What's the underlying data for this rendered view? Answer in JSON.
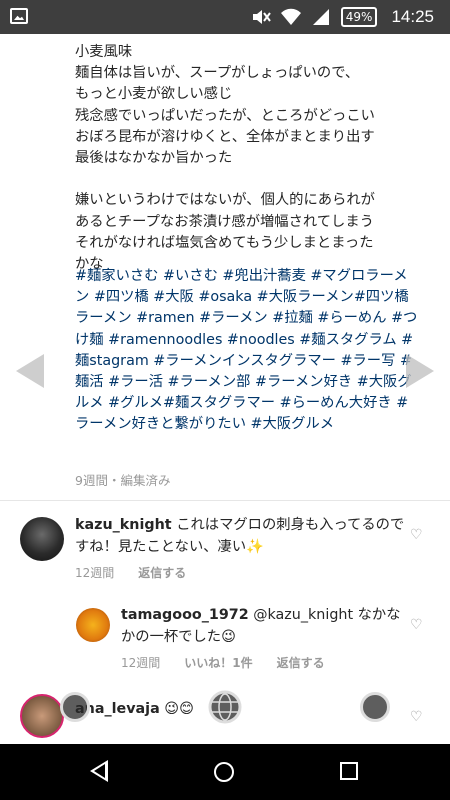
{
  "status_bar": {
    "battery": "49%",
    "time": "14:25"
  },
  "post": {
    "caption": "小麦風味\n麺自体は旨いが、スープがしょっぱいので、\nもっと小麦が欲しい感じ\n残念感でいっぱいだったが、ところがどっこい\nおぼろ昆布が溶けゆくと、全体がまとまり出す\n最後はなかなか旨かった\n\n嫌いというわけではないが、個人的にあられが\nあるとチープなお茶漬け感が増幅されてしまう\nそれがなければ塩気含めてもう少しまとまった\nかな",
    "hashtags": "#麺家いさむ #いさむ #兜出汁蕎麦 #マグロラーメン #四ツ橋 #大阪 #osaka #大阪ラーメン#四ツ橋ラーメン #ramen #ラーメン #拉麺 #らーめん #つけ麺 #ramennoodles #noodles #麺スタグラム #麺stagram #ラーメンインスタグラマー #ラー写 #麺活 #ラー活 #ラーメン部 #ラーメン好き #大阪グルメ #グルメ#麺スタグラマー #らーめん大好き #ラーメン好きと繋がりたい #大阪グルメ",
    "meta": "9週間・編集済み"
  },
  "comments": [
    {
      "username": "kazu_knight",
      "text": "これはマグロの刺身も入ってるのですね！見たことない、凄い✨",
      "time": "12週間",
      "reply": "返信する"
    },
    {
      "username": "tamagooo_1972",
      "text": "@kazu_knight なかなかの一杯でした😉",
      "time": "12週間",
      "likes": "いいね！1件",
      "reply": "返信する"
    },
    {
      "username": "ana_levaja",
      "text": "😉😊"
    }
  ],
  "colors": {
    "hashtag": "#003569",
    "status_bar": "#3e3e3e",
    "nav_bar": "#000000",
    "meta_gray": "#999999"
  }
}
